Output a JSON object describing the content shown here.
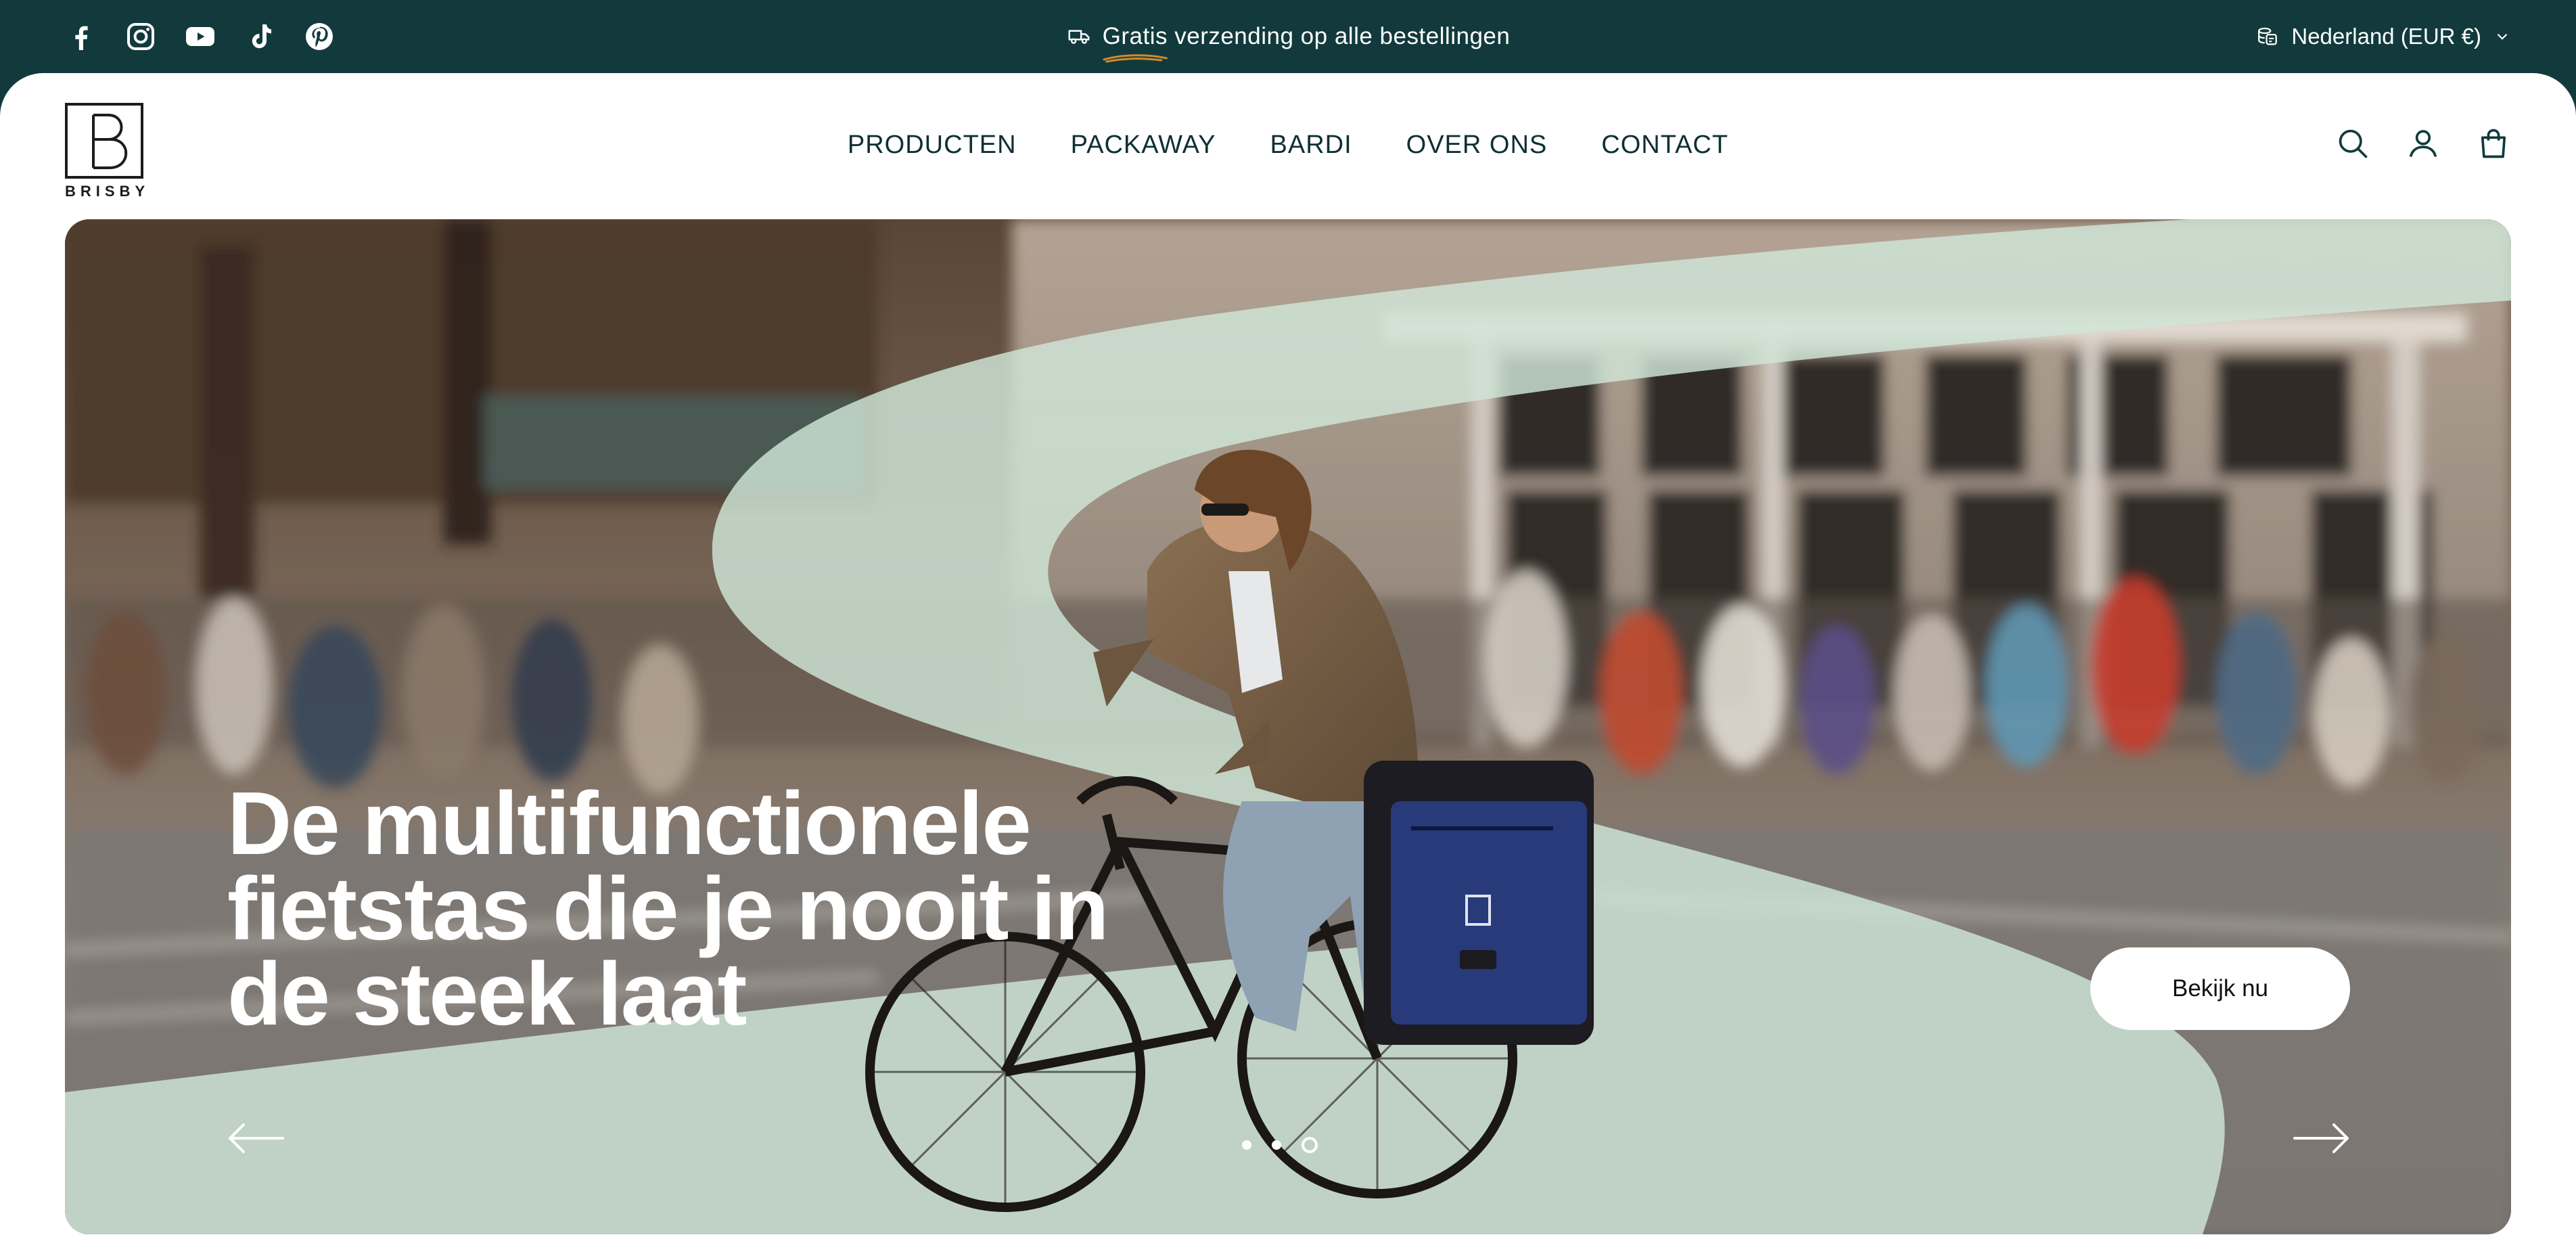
{
  "topbar": {
    "socials": [
      "facebook-icon",
      "instagram-icon",
      "youtube-icon",
      "tiktok-icon",
      "pinterest-icon"
    ],
    "announcement_highlight": "Gratis",
    "announcement_rest": " verzending op alle bestellingen",
    "locale_label": "Nederland (EUR €)"
  },
  "header": {
    "logo_text": "BRISBY",
    "nav": [
      "PRODUCTEN",
      "PACKAWAY",
      "BARDI",
      "OVER ONS",
      "CONTACT"
    ],
    "icons": [
      "search-icon",
      "account-icon",
      "cart-icon"
    ]
  },
  "hero": {
    "headline": "De multifunctionele\nfietstas die je nooit in\nde steek laat",
    "cta_label": "Bekijk nu",
    "slide_count": 3,
    "active_slide": 3
  },
  "colors": {
    "topbar_bg": "#123a3d",
    "nav_text": "#0f2f33",
    "swoosh": "#cfe6d8",
    "bag_blue": "#283a7a"
  }
}
